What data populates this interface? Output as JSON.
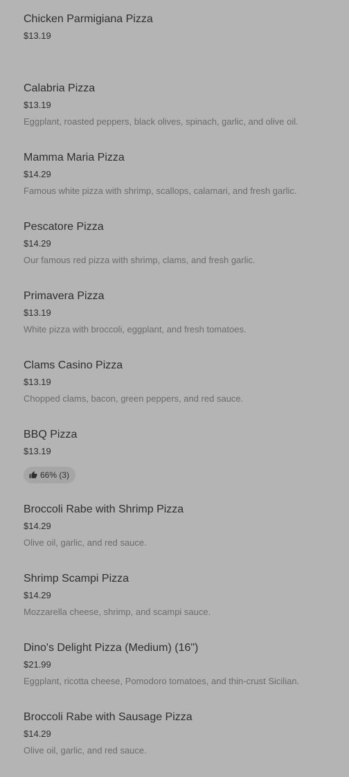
{
  "menu": {
    "items": [
      {
        "name": "Chicken Parmigiana Pizza",
        "price": "$13.19",
        "description": ""
      },
      {
        "name": "Calabria Pizza",
        "price": "$13.19",
        "description": "Eggplant, roasted peppers, black olives, spinach, garlic, and olive oil."
      },
      {
        "name": "Mamma Maria Pizza",
        "price": "$14.29",
        "description": "Famous white pizza with shrimp, scallops, calamari, and fresh garlic."
      },
      {
        "name": "Pescatore Pizza",
        "price": "$14.29",
        "description": "Our famous red pizza with shrimp, clams, and fresh garlic."
      },
      {
        "name": "Primavera Pizza",
        "price": "$13.19",
        "description": "White pizza with broccoli, eggplant, and fresh tomatoes."
      },
      {
        "name": "Clams Casino Pizza",
        "price": "$13.19",
        "description": "Chopped clams, bacon, green peppers, and red sauce."
      },
      {
        "name": "BBQ Pizza",
        "price": "$13.19",
        "badge": "66% (3)",
        "badge_icon": "thumbs-up-icon"
      },
      {
        "name": "Broccoli Rabe with Shrimp Pizza",
        "price": "$14.29",
        "description": "Olive oil, garlic, and red sauce."
      },
      {
        "name": "Shrimp Scampi Pizza",
        "price": "$14.29",
        "description": "Mozzarella cheese, shrimp, and scampi sauce."
      },
      {
        "name": "Dino's Delight Pizza (Medium) (16\")",
        "price": "$21.99",
        "description": "Eggplant, ricotta cheese, Pomodoro tomatoes, and thin-crust Sicilian."
      },
      {
        "name": "Broccoli Rabe with Sausage Pizza",
        "price": "$14.29",
        "description": "Olive oil, garlic, and red sauce."
      }
    ]
  },
  "colors": {
    "background": "#b4b4b4",
    "text_primary": "#2e2e2e",
    "text_secondary": "#6b6b6b",
    "badge_bg": "#a6a6a6"
  }
}
